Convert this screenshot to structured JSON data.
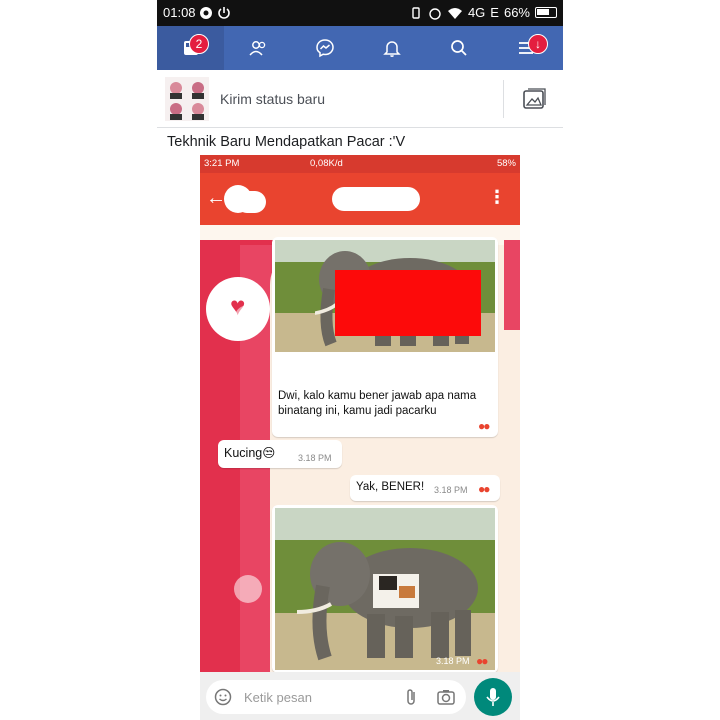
{
  "status_bar": {
    "time": "01:08",
    "network": "4G",
    "network2": "E",
    "battery": "66%"
  },
  "fb_nav": {
    "items": [
      {
        "icon": "news-feed-icon",
        "badge": "2"
      },
      {
        "icon": "friends-icon"
      },
      {
        "icon": "messenger-icon"
      },
      {
        "icon": "notifications-bell-icon"
      },
      {
        "icon": "search-icon"
      },
      {
        "icon": "menu-icon",
        "badge": "↓"
      }
    ],
    "color": "#4267b2"
  },
  "composer": {
    "placeholder": "Kirim status baru"
  },
  "post": {
    "text": "Tekhnik Baru Mendapatkan Pacar :'V",
    "screenshot": {
      "status": {
        "time": "3:21 PM",
        "speed": "0,08K/d",
        "battery": "58%"
      },
      "messages": [
        {
          "id": "m1",
          "text": "Dwi, kalo kamu bener jawab apa nama binatang ini, kamu jadi pacarku"
        },
        {
          "id": "m2",
          "text": "Kucing😒",
          "time": "3.18 PM"
        },
        {
          "id": "m3",
          "text": "Yak, BENER!",
          "time": "3.18 PM"
        },
        {
          "id": "m4",
          "time": "3.18 PM"
        }
      ],
      "input_placeholder": "Ketik pesan",
      "accent": "#e9442f"
    }
  }
}
